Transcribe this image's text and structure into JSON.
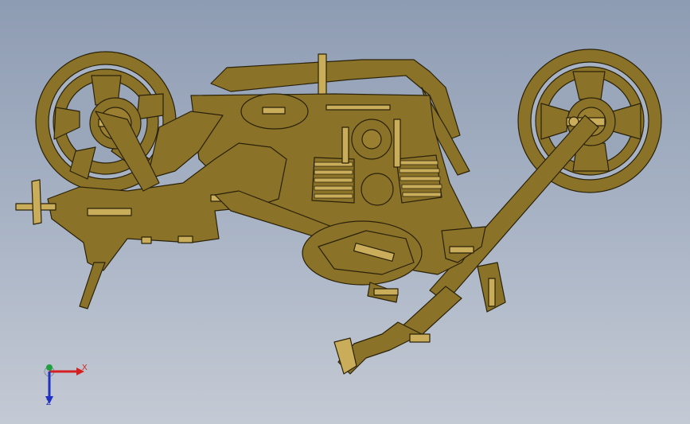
{
  "viewport": {
    "background_top": "#8e9cb3",
    "background_bottom": "#c4cad4"
  },
  "model": {
    "part_color": "#8b7229",
    "edge_color": "#2a2208",
    "highlight_color": "#c9ad5b"
  },
  "triad": {
    "x_label": "X",
    "z_label": "Z",
    "x_color": "#d42020",
    "y_color": "#20a040",
    "z_color": "#2030c0"
  }
}
